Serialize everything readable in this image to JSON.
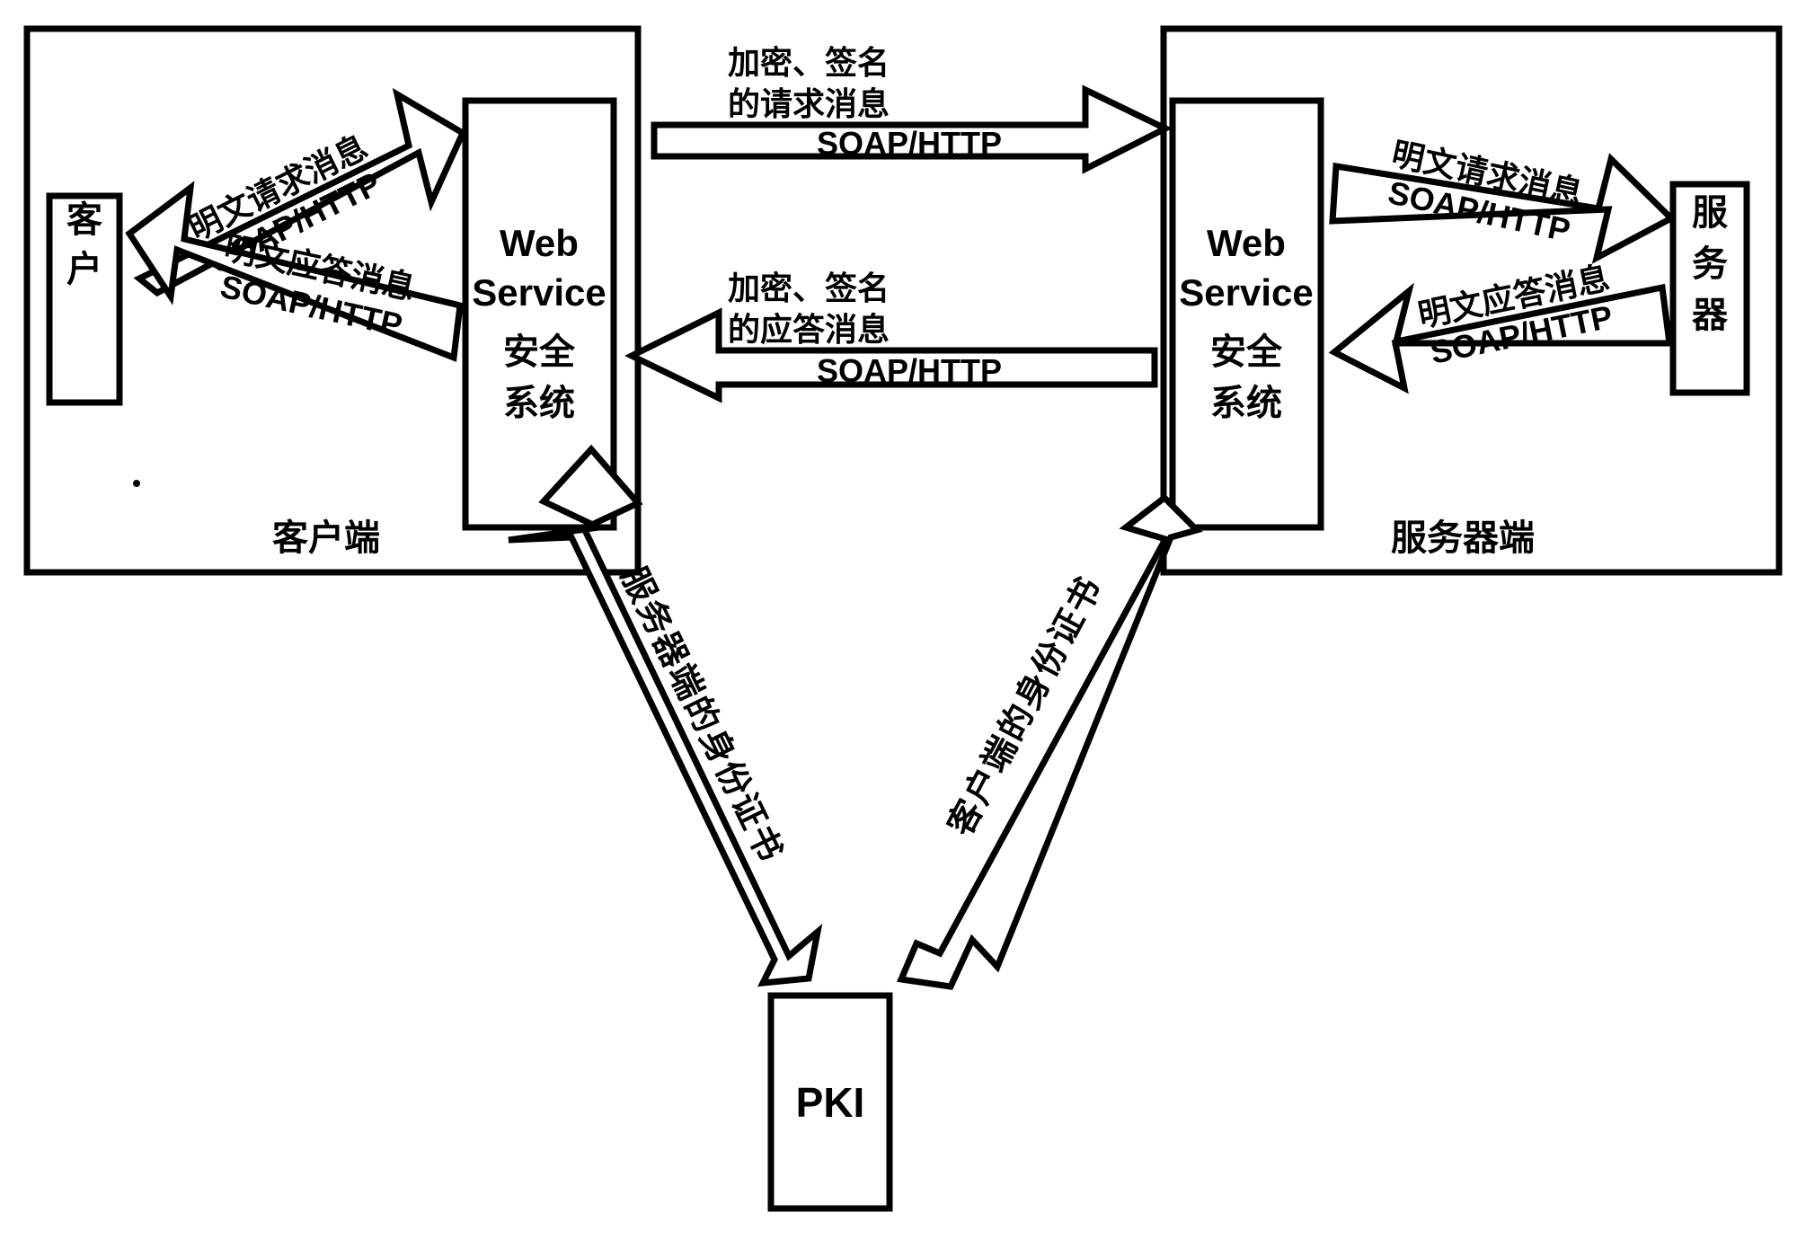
{
  "diagram": {
    "title_elements": {
      "client_zone_label": "客户端",
      "server_zone_label": "服务器端"
    },
    "nodes": {
      "client": {
        "label_chars": [
          "客",
          "户"
        ],
        "label": "客户"
      },
      "client_ws": {
        "line1": "Web",
        "line2": "Service",
        "line3": "安全",
        "line4": "系统"
      },
      "server_ws": {
        "line1": "Web",
        "line2": "Service",
        "line3": "安全",
        "line4": "系统"
      },
      "server": {
        "label_chars": [
          "服",
          "务",
          "器"
        ],
        "label": "服务器"
      },
      "pki": {
        "label": "PKI"
      }
    },
    "arrows": {
      "client_to_ws": {
        "line1": "明文请求消息",
        "line2": "SOAP/HTTP",
        "direction": "up-right"
      },
      "ws_to_client": {
        "line1": "明文应答消息",
        "line2": "SOAP/HTTP",
        "direction": "down-left"
      },
      "client_ws_to_server_ws": {
        "line1": "加密、签名",
        "line2": "的请求消息",
        "line3": "SOAP/HTTP",
        "direction": "right"
      },
      "server_ws_to_client_ws": {
        "line1": "加密、签名",
        "line2": "的应答消息",
        "line3": "SOAP/HTTP",
        "direction": "left"
      },
      "server_ws_to_server": {
        "line1": "明文请求消息",
        "line2": "SOAP/HTTP",
        "direction": "down-right"
      },
      "server_to_server_ws": {
        "line1": "明文应答消息",
        "line2": "SOAP/HTTP",
        "direction": "up-left"
      },
      "client_ws_pki": {
        "label": "服务器端的身份证书",
        "direction": "bidirectional"
      },
      "server_ws_pki": {
        "label": "客户端的身份证书",
        "direction": "bidirectional"
      }
    },
    "colors": {
      "stroke": "#000000",
      "fill": "#ffffff",
      "background": "#ffffff"
    }
  }
}
